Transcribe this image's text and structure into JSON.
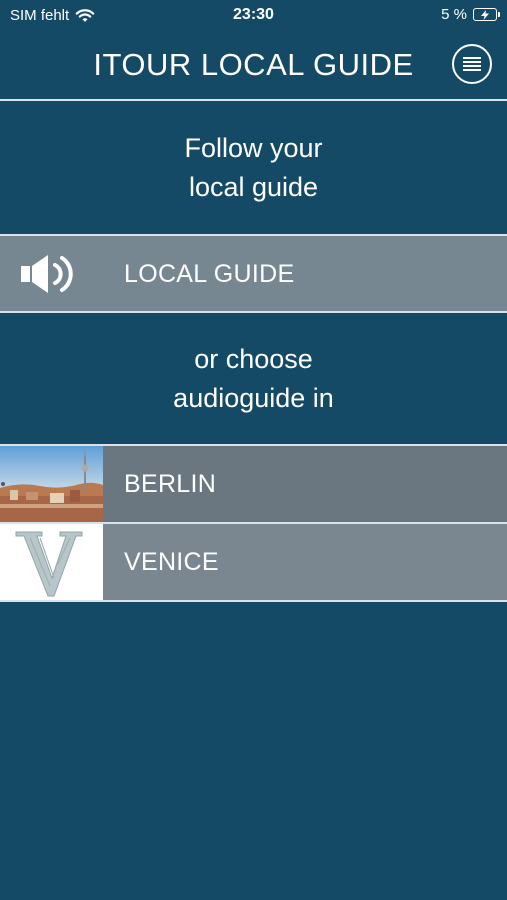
{
  "status": {
    "carrier": "SIM fehlt",
    "time": "23:30",
    "battery": "5 %"
  },
  "header": {
    "title": "ITOUR LOCAL GUIDE",
    "menu_icon": "hamburger-menu-icon"
  },
  "intro": {
    "line1": "Follow your",
    "line2": "local guide"
  },
  "local_guide": {
    "label": "LOCAL GUIDE",
    "icon": "speaker-icon"
  },
  "choose": {
    "line1": "or choose",
    "line2": "audioguide in"
  },
  "cities": [
    {
      "label": "BERLIN",
      "thumb": "berlin-skyline-thumbnail"
    },
    {
      "label": "VENICE",
      "thumb": "venice-v-logo-thumbnail"
    }
  ],
  "colors": {
    "background": "#154a66",
    "row_gray": "#778792",
    "divider": "#d8e2e8"
  }
}
